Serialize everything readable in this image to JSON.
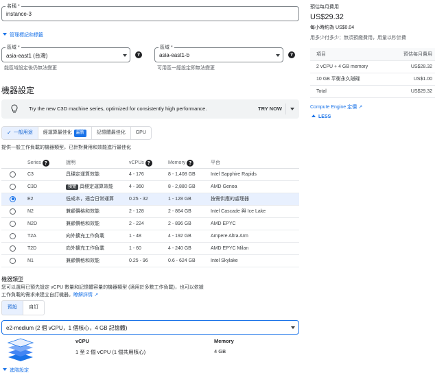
{
  "name_field": {
    "label": "名稱 *",
    "value": "instance-3"
  },
  "manage_labels": "管理標記和標籤",
  "region": {
    "label": "區域 *",
    "value": "asia-east1 (台灣)",
    "hint": "能區域設定後仍無法變更"
  },
  "zone": {
    "label": "區域 *",
    "value": "asia-east1-b",
    "hint": "可用區一經設定即無法變更"
  },
  "machine_config_title": "機器設定",
  "banner": {
    "text": "Try the new C3D machine series, optimized for consistently high performance.",
    "action": "TRY NOW"
  },
  "family_tabs": [
    {
      "label": "一般用途",
      "active": true,
      "badge": ""
    },
    {
      "label": "經運算最佳化",
      "active": false,
      "badge": "最新"
    },
    {
      "label": "記憶體最佳化",
      "active": false,
      "badge": ""
    },
    {
      "label": "GPU",
      "active": false,
      "badge": ""
    }
  ],
  "family_description": "提供一般工作負載的機器類型，已針對費用和效能進行最佳化",
  "series_table": {
    "headers": [
      "Series",
      "說明",
      "vCPUs",
      "Memory",
      "平台"
    ],
    "rows": [
      {
        "series": "C3",
        "desc": "具穩定運算效能",
        "vcpus": "4 - 176",
        "memory": "8 - 1,408 GB",
        "platform": "Intel Sapphire Rapids",
        "selected": false,
        "badge": ""
      },
      {
        "series": "C3D",
        "desc": "具穩定運算效能",
        "vcpus": "4 - 360",
        "memory": "8 - 2,880 GB",
        "platform": "AMD Genoa",
        "selected": false,
        "badge": "預覽"
      },
      {
        "series": "E2",
        "desc": "低成本，適合日常運算",
        "vcpus": "0.25 - 32",
        "memory": "1 - 128 GB",
        "platform": "按需供應的處理器",
        "selected": true,
        "badge": ""
      },
      {
        "series": "N2",
        "desc": "兼顧價格和效能",
        "vcpus": "2 - 128",
        "memory": "2 - 864 GB",
        "platform": "Intel Cascade 與 Ice Lake",
        "selected": false,
        "badge": ""
      },
      {
        "series": "N2D",
        "desc": "兼顧價格和效能",
        "vcpus": "2 - 224",
        "memory": "2 - 896 GB",
        "platform": "AMD EPYC",
        "selected": false,
        "badge": ""
      },
      {
        "series": "T2A",
        "desc": "向外擴充工作負載",
        "vcpus": "1 - 48",
        "memory": "4 - 192 GB",
        "platform": "Ampere Altra Arm",
        "selected": false,
        "badge": ""
      },
      {
        "series": "T2D",
        "desc": "向外擴充工作負載",
        "vcpus": "1 - 60",
        "memory": "4 - 240 GB",
        "platform": "AMD EPYC Milan",
        "selected": false,
        "badge": ""
      },
      {
        "series": "N1",
        "desc": "兼顧價格和效能",
        "vcpus": "0.25 - 96",
        "memory": "0.6 - 624 GB",
        "platform": "Intel Skylake",
        "selected": false,
        "badge": ""
      }
    ]
  },
  "machine_type": {
    "title": "機器類型",
    "desc_line1": "您可以選用已預先設定 vCPU 數量和記憶體容量的機器類型 (適用於多數工作負載)，也可以依據",
    "desc_line2": "工作負載的需求來建立自訂機器。",
    "desc_link": "瞭解詳情",
    "segments": [
      {
        "label": "預設",
        "active": true
      },
      {
        "label": "自訂",
        "active": false
      }
    ],
    "selected": "e2-medium (2 個 vCPU，1 個核心，4 GB 記憶體)",
    "vcpu_label": "vCPU",
    "vcpu_value": "1 至 2 個 vCPU (1 個共用核心)",
    "memory_label": "Memory",
    "memory_value": "4 GB"
  },
  "advanced": "進階設定",
  "pricing": {
    "title": "預估每月費用",
    "monthly": "US$29.32",
    "hourly": "每小時約為 US$0.04",
    "note": "用多少付多少：無須預繳費用，用量以秒計費",
    "headers": [
      "項目",
      "預估每月費用"
    ],
    "rows": [
      {
        "item": "2 vCPU + 4 GB memory",
        "cost": "US$28.32"
      },
      {
        "item": "10 GB 平衡永久磁碟",
        "cost": "US$1.00"
      },
      {
        "item": "Total",
        "cost": "US$29.32"
      }
    ],
    "link": "Compute Engine 定價",
    "less": "LESS"
  }
}
